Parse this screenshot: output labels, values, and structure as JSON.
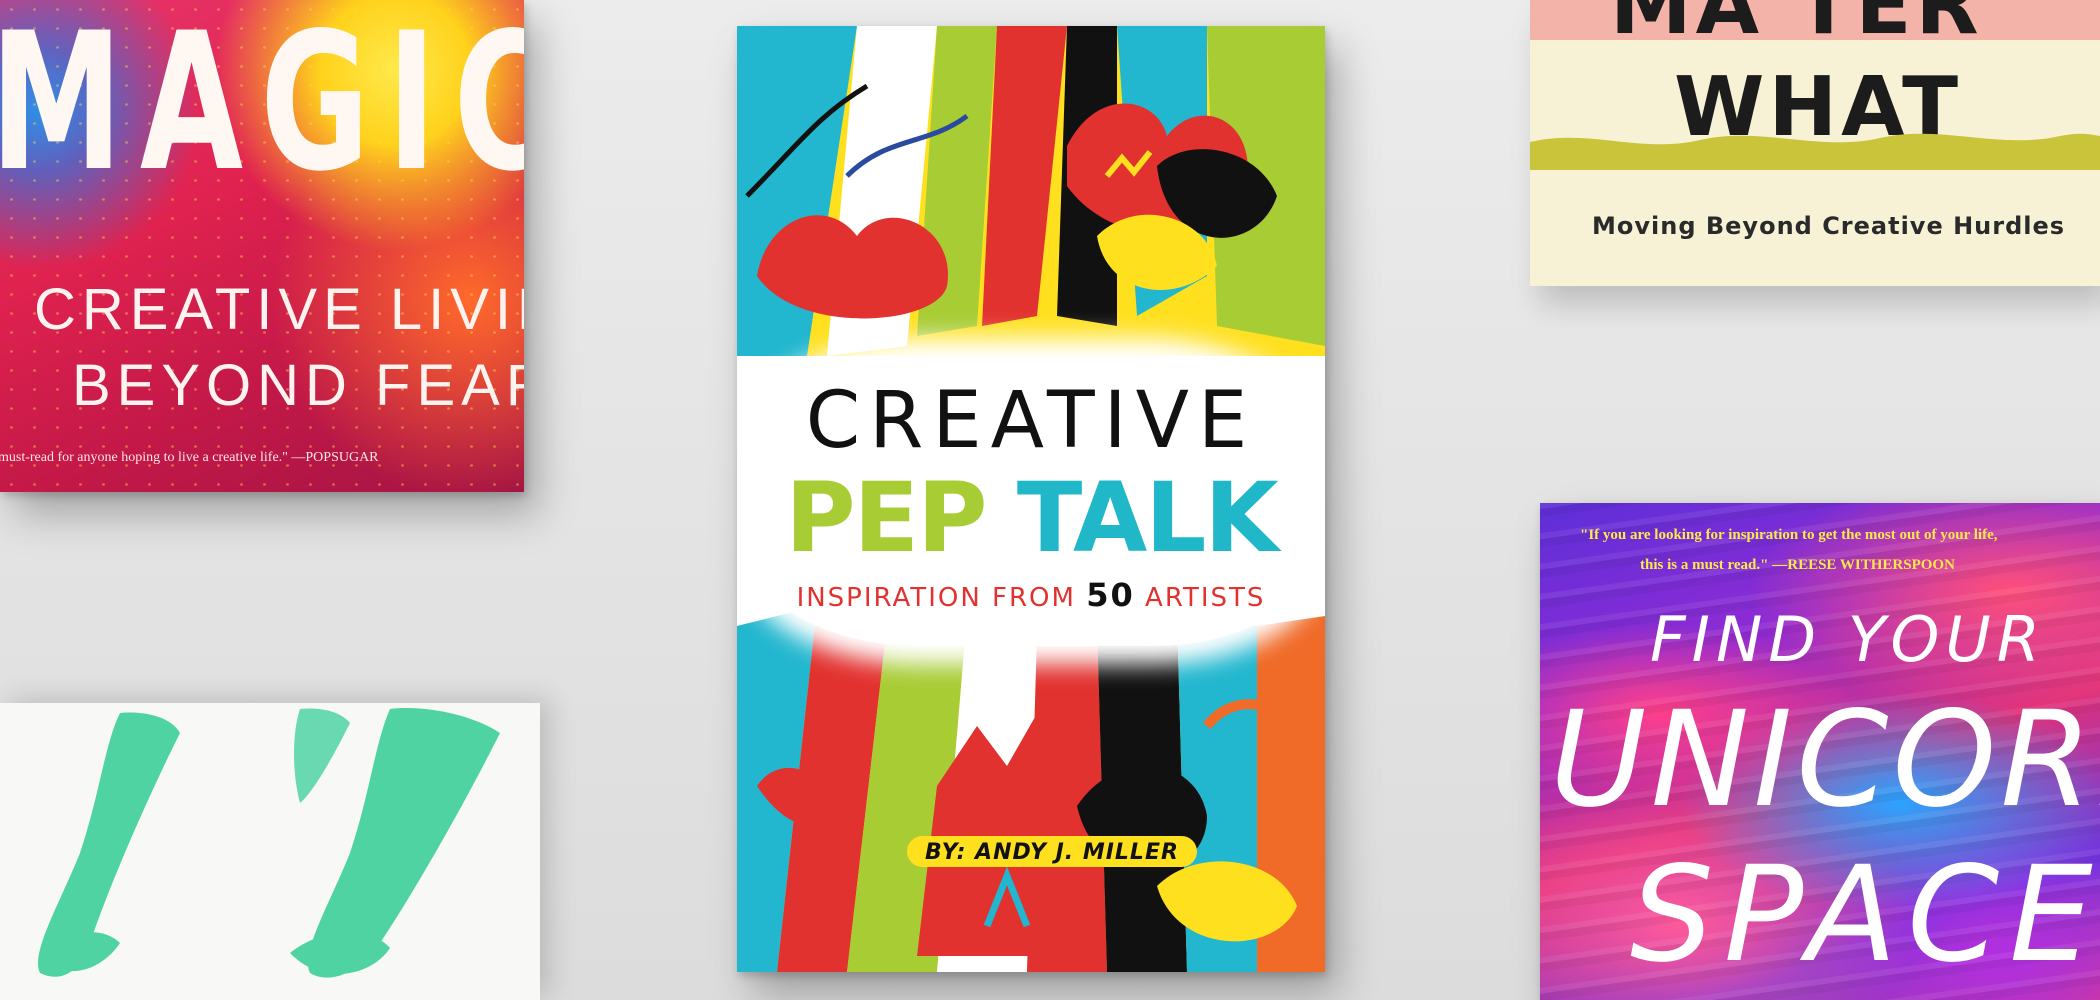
{
  "books": {
    "big_magic": {
      "title": "MAGIC",
      "subtitle_line1": "CREATIVE LIVING",
      "subtitle_line2": "BEYOND FEAR",
      "quote": "must-read for anyone hoping to live a creative life.\" —POPSUGAR"
    },
    "pep_talk": {
      "title_line1": "CREATIVE",
      "title_word1": "PEP",
      "title_word2": "TALK",
      "tagline_pre": "INSPIRATION FROM ",
      "tagline_number": "50",
      "tagline_post": " ARTISTS",
      "author": "BY: ANDY J. MILLER"
    },
    "matter_what": {
      "title_top_partial": "MA TER",
      "title_line2": "WHAT",
      "subtitle": "Moving Beyond Creative Hurdles"
    },
    "unicorn_space": {
      "quote_line1": "\"If you are looking for inspiration to get the most out of your life,",
      "quote_line2": "this is a must read.\" —REESE WITHERSPOON",
      "title_line1": "FIND YOUR",
      "title_line2": "UNICORN",
      "title_line3": "SPACE"
    }
  },
  "colors": {
    "background": "#e6e6e6",
    "pep_green": "#a8cc34",
    "pep_teal": "#20b7c8",
    "pep_red": "#e2322f",
    "pep_yellow": "#ffe01f",
    "matter_cream": "#f7f1d6",
    "matter_olive": "#c9c43a",
    "green_brush": "#4fd3a3"
  }
}
